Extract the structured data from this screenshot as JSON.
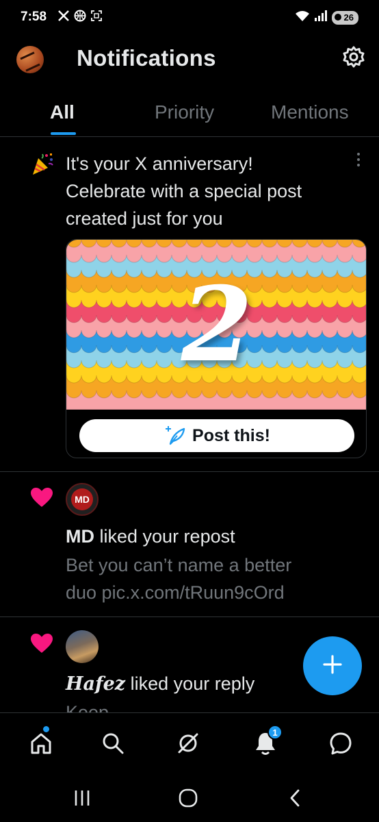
{
  "status_bar": {
    "time": "7:58",
    "left_icons": [
      "x-logo-icon",
      "basketball-icon",
      "screenshot-icon"
    ],
    "right_icons": [
      "wifi-icon",
      "signal-icon"
    ],
    "battery": "26"
  },
  "header": {
    "title": "Notifications",
    "settings_icon": "gear-icon"
  },
  "tabs": [
    {
      "label": "All",
      "active": true
    },
    {
      "label": "Priority",
      "active": false
    },
    {
      "label": "Mentions",
      "active": false
    }
  ],
  "anniversary": {
    "line1": "It's your X anniversary!",
    "line2": "Celebrate with a special post",
    "line3": "created just for you",
    "card_number": "2",
    "button_label": "Post this!"
  },
  "notifications": [
    {
      "user": "MD",
      "avatar_text": "MD",
      "action": " liked your repost",
      "line2": "Bet you can’t name a better",
      "line3": "duo pic.x.com/tRuun9cOrd"
    },
    {
      "user": "Hafez",
      "action": " liked your reply",
      "line2": "Keep"
    }
  ],
  "fab": {
    "icon": "plus-icon"
  },
  "bottom_nav": {
    "items": [
      "home-icon",
      "search-icon",
      "grok-icon",
      "bell-icon",
      "messages-icon"
    ],
    "notification_badge": "1"
  },
  "colors": {
    "accent": "#1d9bf0",
    "like": "#f91880",
    "background": "#000000",
    "muted_text": "#71767b"
  }
}
